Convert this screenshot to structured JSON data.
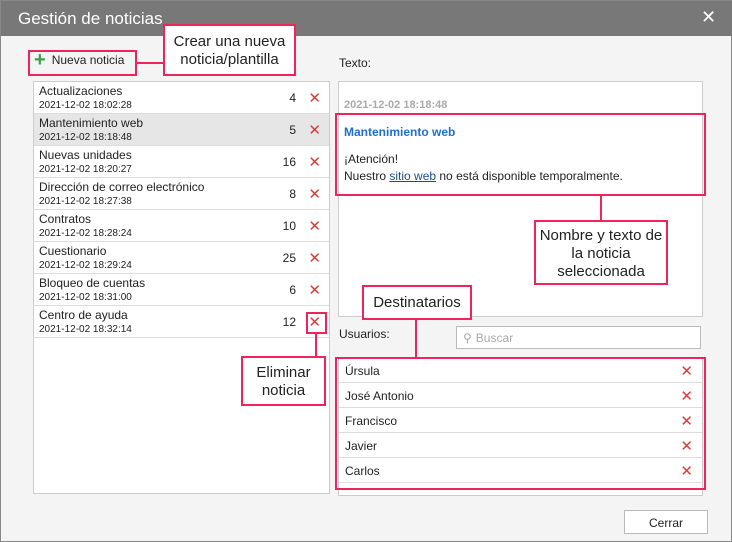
{
  "window": {
    "title": "Gestión de noticias",
    "close_icon": "close-icon"
  },
  "toolbar": {
    "new_label": "Nueva noticia"
  },
  "news": [
    {
      "name": "Actualizaciones",
      "date": "2021-12-02 18:02:28",
      "count": "4"
    },
    {
      "name": "Mantenimiento web",
      "date": "2021-12-02 18:18:48",
      "count": "5",
      "selected": true
    },
    {
      "name": "Nuevas unidades",
      "date": "2021-12-02 18:20:27",
      "count": "16"
    },
    {
      "name": "Dirección de correo electrónico",
      "date": "2021-12-02 18:27:38",
      "count": "8"
    },
    {
      "name": "Contratos",
      "date": "2021-12-02 18:28:24",
      "count": "10"
    },
    {
      "name": "Cuestionario",
      "date": "2021-12-02 18:29:24",
      "count": "25"
    },
    {
      "name": "Bloqueo de cuentas",
      "date": "2021-12-02 18:31:00",
      "count": "6"
    },
    {
      "name": "Centro de ayuda",
      "date": "2021-12-02 18:32:14",
      "count": "12"
    }
  ],
  "detail": {
    "label": "Texto:",
    "timestamp": "2021-12-02 18:18:48",
    "title": "Mantenimiento web",
    "line1": "¡Atención!",
    "line2_pre": "Nuestro ",
    "link": "sitio web",
    "line2_post": " no está disponible temporalmente."
  },
  "recipients": {
    "label": "Usuarios:",
    "search_placeholder": "Buscar",
    "users": [
      "Úrsula",
      "José Antonio",
      "Francisco",
      "Javier",
      "Carlos"
    ]
  },
  "footer": {
    "close_label": "Cerrar"
  },
  "annotations": {
    "create": "Crear una nueva noticia/plantilla",
    "delete": "Eliminar noticia",
    "detail": "Nombre y texto de la noticia seleccionada",
    "recipients": "Destinatarios"
  },
  "delete_glyph": "✕"
}
